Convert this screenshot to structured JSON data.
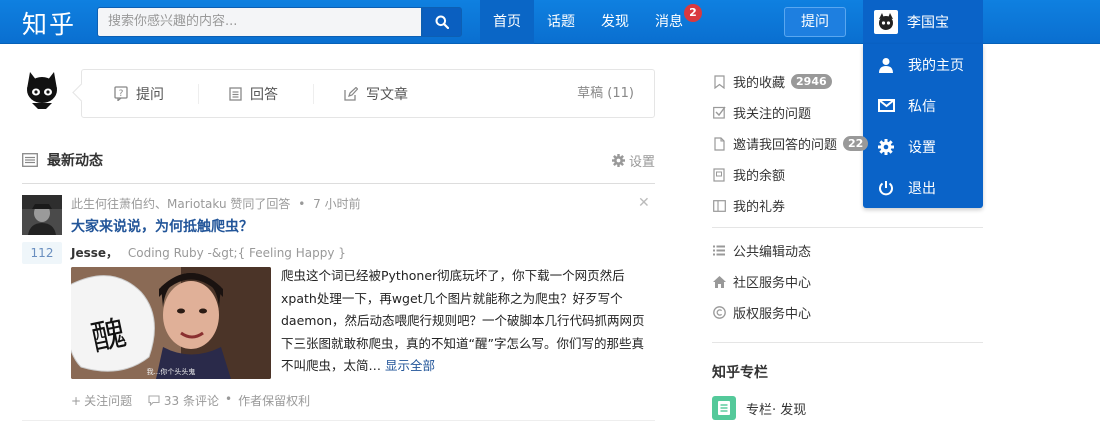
{
  "header": {
    "logo": "知乎",
    "search_placeholder": "搜索你感兴趣的内容...",
    "nav": [
      {
        "label": "首页",
        "active": true
      },
      {
        "label": "话题"
      },
      {
        "label": "发现"
      },
      {
        "label": "消息",
        "badge": "2"
      }
    ],
    "ask_label": "提问",
    "user_name": "李国宝"
  },
  "user_menu": [
    {
      "label": "我的主页",
      "icon": "person-icon"
    },
    {
      "label": "私信",
      "icon": "envelope-icon"
    },
    {
      "label": "设置",
      "icon": "gear-icon"
    },
    {
      "label": "退出",
      "icon": "power-icon"
    }
  ],
  "composer": {
    "ask": "提问",
    "answer": "回答",
    "write": "写文章",
    "drafts": "草稿 (11)"
  },
  "feed": {
    "title": "最新动态",
    "settings": "设置",
    "item": {
      "meta": "此生何往萧伯约、Mariotaku 赞同了回答",
      "time": "7 小时前",
      "question": "大家来说说，为何抵触爬虫？",
      "votes": "112",
      "author_name": "Jesse",
      "author_bio": "Coding Ruby -&gt;{ Feeling Happy }",
      "excerpt": "爬虫这个词已经被Pythoner彻底玩坏了，你下载一个网页然后xpath处理一下，再wget几个图片就能称之为爬虫？好歹写个daemon，然后动态喂爬行规则吧？一个破脚本几行代码抓两网页下三张图就敢称爬虫，真的不知道“醒”字怎么写。你们写的那些真不叫爬虫，太简…",
      "show_all": "显示全部",
      "actions": {
        "follow": "关注问题",
        "comments": "33 条评论",
        "rights": "作者保留权利"
      },
      "image_caption": "我...你个头头鬼"
    }
  },
  "sidebar": {
    "items": [
      {
        "label": "我的收藏",
        "icon": "bookmark-icon",
        "badge": "2946"
      },
      {
        "label": "我关注的问题",
        "icon": "checkbox-icon"
      },
      {
        "label": "邀请我回答的问题",
        "icon": "document-icon",
        "badge": "22"
      },
      {
        "label": "我的余额",
        "icon": "wallet-icon"
      },
      {
        "label": "我的礼券",
        "icon": "coupon-icon"
      }
    ],
    "items2": [
      {
        "label": "公共编辑动态",
        "icon": "list-icon"
      },
      {
        "label": "社区服务中心",
        "icon": "home-icon"
      },
      {
        "label": "版权服务中心",
        "icon": "copyright-icon"
      }
    ],
    "column_title": "知乎专栏",
    "column_item": "专栏· 发现"
  }
}
